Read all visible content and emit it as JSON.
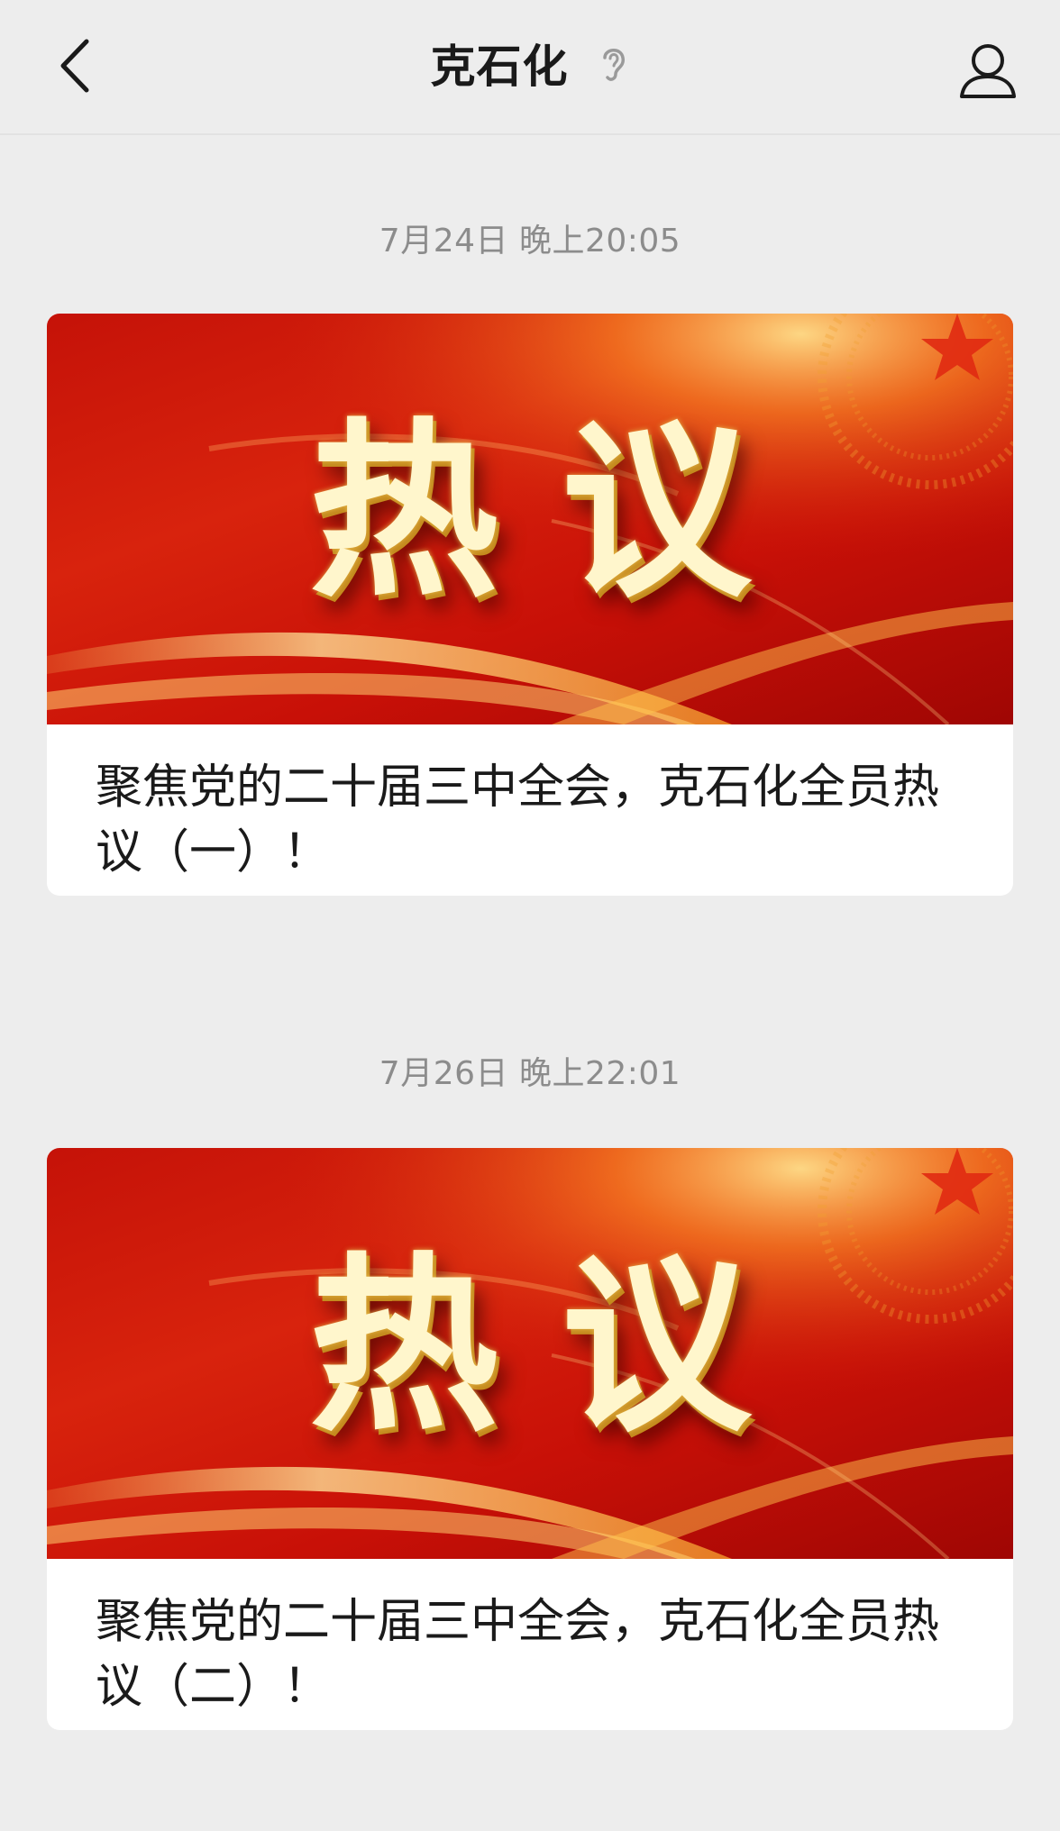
{
  "header": {
    "title": "克石化",
    "back_icon": "chevron-left-icon",
    "ear_icon": "ear-icon",
    "profile_icon": "user-icon"
  },
  "messages": [
    {
      "date": "7月24日 晚上20:05",
      "banner_text": [
        "热",
        "议"
      ],
      "title": "聚焦党的二十届三中全会，克石化全员热议（一）！"
    },
    {
      "date": "7月26日 晚上22:01",
      "banner_text": [
        "热",
        "议"
      ],
      "title": "聚焦党的二十届三中全会，克石化全员热议（二）！"
    }
  ],
  "colors": {
    "background": "#ededed",
    "banner_red": "#c81007",
    "banner_gold": "#ffd86a"
  }
}
